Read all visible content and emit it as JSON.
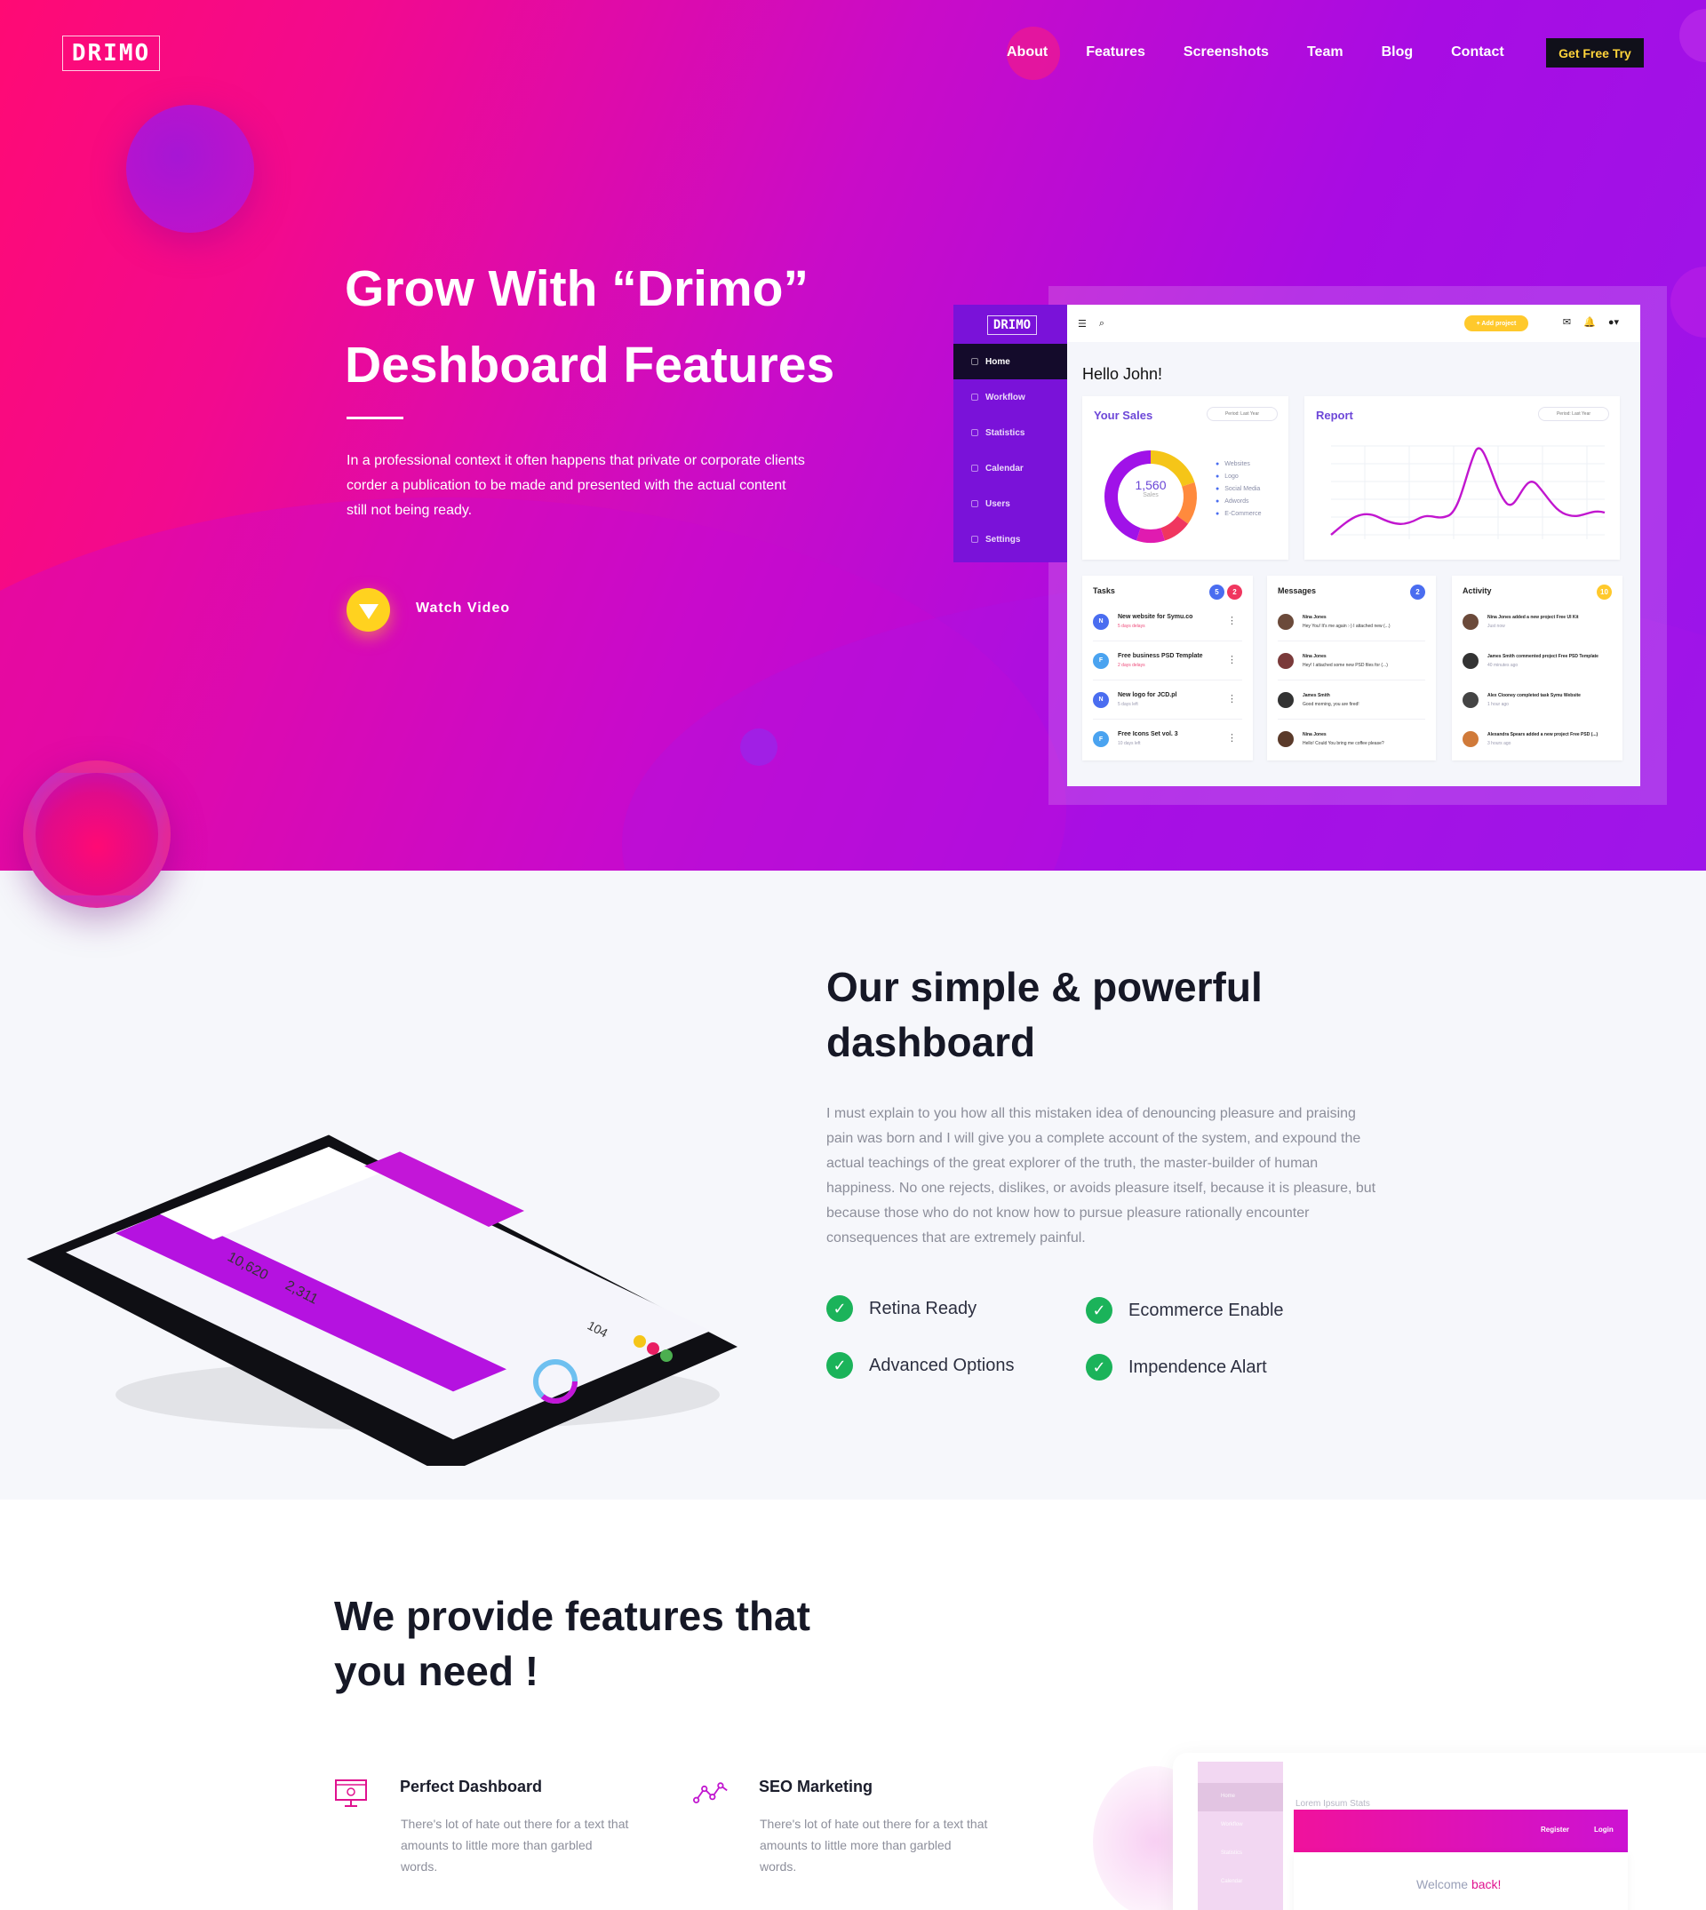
{
  "brand": {
    "logo": "DRIMO"
  },
  "nav": {
    "items": [
      "About",
      "Features",
      "Screenshots",
      "Team",
      "Blog",
      "Contact"
    ],
    "cta": "Get Free Try"
  },
  "hero": {
    "title_line1": "Grow With “Drimo”",
    "title_line2": "Deshboard Features",
    "text": "In a professional context it often happens that private or corporate clients corder a publication to be made and presented with the actual content still not being ready.",
    "video_label": "Watch Video"
  },
  "dashboard": {
    "logo": "DRIMO",
    "sidebar": [
      "Home",
      "Workflow",
      "Statistics",
      "Calendar",
      "Users",
      "Settings"
    ],
    "add_project": "+ Add project",
    "greeting": "Hello John!",
    "sales": {
      "title": "Your Sales",
      "period": "Period: Last Year",
      "total": "1,560",
      "total_label": "Sales",
      "legend": [
        "Websites",
        "Logo",
        "Social Media",
        "Adwords",
        "E-Commerce"
      ]
    },
    "report": {
      "title": "Report",
      "period": "Period: Last Year"
    },
    "tasks": {
      "title": "Tasks",
      "badge_a": "5",
      "badge_b": "2",
      "items": [
        {
          "initial": "N",
          "title": "New website for Symu.co",
          "meta": "5 days delays"
        },
        {
          "initial": "F",
          "title": "Free business PSD Template",
          "meta": "2 days delays"
        },
        {
          "initial": "N",
          "title": "New logo for JCD.pl",
          "meta": "5 days left"
        },
        {
          "initial": "F",
          "title": "Free Icons Set vol. 3",
          "meta": "10 days left"
        }
      ]
    },
    "messages": {
      "title": "Messages",
      "badge": "2",
      "items": [
        {
          "name": "Nina Jones",
          "text": "Hey You! It's me again :-) I attached new (...)"
        },
        {
          "name": "Nina Jones",
          "text": "Hey! I attached some new PSD files for (...)"
        },
        {
          "name": "James Smith",
          "text": "Good morning, you are fired!"
        },
        {
          "name": "Nina Jones",
          "text": "Hello! Could You bring me coffee please?"
        }
      ]
    },
    "activity": {
      "title": "Activity",
      "badge": "10",
      "items": [
        {
          "text": "Nina Jones added a new project Free UI Kit",
          "meta": "Just now"
        },
        {
          "text": "James Smith commented project Free PSD Template",
          "meta": "40 minutes ago"
        },
        {
          "text": "Alex Clooney completed task Symu Website",
          "meta": "1 hour ago"
        },
        {
          "text": "Alexandra Spears added a new project Free PSD (...)",
          "meta": "3 hours ago"
        }
      ]
    }
  },
  "section2": {
    "title": "Our simple & powerful dashboard",
    "text": "I must explain to you how all this mistaken idea of denouncing pleasure and praising pain was born and I will give you a complete account of the system, and expound the actual teachings of the great explorer of the truth, the master-builder of human happiness. No one rejects, dislikes, or avoids pleasure itself, because it is pleasure, but because those who do not know how to pursue pleasure rationally encounter consequences that are extremely painful.",
    "features": [
      "Retina Ready",
      "Ecommerce Enable",
      "Advanced Options",
      "Impendence Alart"
    ],
    "tablet": {
      "stat1": "10,620",
      "stat2": "2,311",
      "stat3": "104"
    }
  },
  "section3": {
    "title": "We provide features that you need !",
    "features": [
      {
        "title": "Perfect Dashboard",
        "text": "There's lot of hate out there for a text that amounts to little more than garbled words."
      },
      {
        "title": "SEO Marketing",
        "text": "There's lot of hate out there for a text that amounts to little more than garbled words."
      }
    ],
    "mock": {
      "sidebar": [
        "Home",
        "Workflow",
        "Statistics",
        "Calendar"
      ],
      "title": "Lorem Ipsum Stats",
      "register": "Register",
      "login": "Login",
      "welcome": "Welcome",
      "back": "back!"
    }
  },
  "colors": {
    "hero_pink": "#ff0a74",
    "hero_purple": "#9a16ea",
    "cta_text": "#ffd43b",
    "check_green": "#1bb35a",
    "accent": "#e0128f"
  },
  "chart_data": {
    "type": "pie",
    "categories": [
      "Websites",
      "Logo",
      "Social Media",
      "Adwords",
      "E-Commerce"
    ],
    "values": [
      20,
      15,
      10,
      10,
      45
    ],
    "title": "Your Sales"
  }
}
